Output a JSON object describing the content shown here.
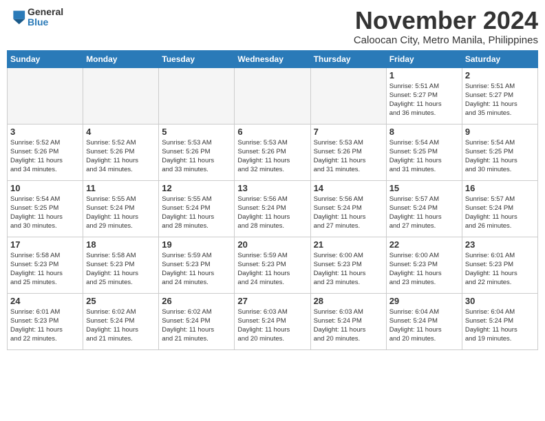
{
  "logo": {
    "general": "General",
    "blue": "Blue"
  },
  "title": "November 2024",
  "subtitle": "Caloocan City, Metro Manila, Philippines",
  "weekdays": [
    "Sunday",
    "Monday",
    "Tuesday",
    "Wednesday",
    "Thursday",
    "Friday",
    "Saturday"
  ],
  "weeks": [
    [
      {
        "day": "",
        "info": "",
        "empty": true
      },
      {
        "day": "",
        "info": "",
        "empty": true
      },
      {
        "day": "",
        "info": "",
        "empty": true
      },
      {
        "day": "",
        "info": "",
        "empty": true
      },
      {
        "day": "",
        "info": "",
        "empty": true
      },
      {
        "day": "1",
        "info": "Sunrise: 5:51 AM\nSunset: 5:27 PM\nDaylight: 11 hours\nand 36 minutes.",
        "empty": false
      },
      {
        "day": "2",
        "info": "Sunrise: 5:51 AM\nSunset: 5:27 PM\nDaylight: 11 hours\nand 35 minutes.",
        "empty": false
      }
    ],
    [
      {
        "day": "3",
        "info": "Sunrise: 5:52 AM\nSunset: 5:26 PM\nDaylight: 11 hours\nand 34 minutes.",
        "empty": false
      },
      {
        "day": "4",
        "info": "Sunrise: 5:52 AM\nSunset: 5:26 PM\nDaylight: 11 hours\nand 34 minutes.",
        "empty": false
      },
      {
        "day": "5",
        "info": "Sunrise: 5:53 AM\nSunset: 5:26 PM\nDaylight: 11 hours\nand 33 minutes.",
        "empty": false
      },
      {
        "day": "6",
        "info": "Sunrise: 5:53 AM\nSunset: 5:26 PM\nDaylight: 11 hours\nand 32 minutes.",
        "empty": false
      },
      {
        "day": "7",
        "info": "Sunrise: 5:53 AM\nSunset: 5:26 PM\nDaylight: 11 hours\nand 31 minutes.",
        "empty": false
      },
      {
        "day": "8",
        "info": "Sunrise: 5:54 AM\nSunset: 5:25 PM\nDaylight: 11 hours\nand 31 minutes.",
        "empty": false
      },
      {
        "day": "9",
        "info": "Sunrise: 5:54 AM\nSunset: 5:25 PM\nDaylight: 11 hours\nand 30 minutes.",
        "empty": false
      }
    ],
    [
      {
        "day": "10",
        "info": "Sunrise: 5:54 AM\nSunset: 5:25 PM\nDaylight: 11 hours\nand 30 minutes.",
        "empty": false
      },
      {
        "day": "11",
        "info": "Sunrise: 5:55 AM\nSunset: 5:24 PM\nDaylight: 11 hours\nand 29 minutes.",
        "empty": false
      },
      {
        "day": "12",
        "info": "Sunrise: 5:55 AM\nSunset: 5:24 PM\nDaylight: 11 hours\nand 28 minutes.",
        "empty": false
      },
      {
        "day": "13",
        "info": "Sunrise: 5:56 AM\nSunset: 5:24 PM\nDaylight: 11 hours\nand 28 minutes.",
        "empty": false
      },
      {
        "day": "14",
        "info": "Sunrise: 5:56 AM\nSunset: 5:24 PM\nDaylight: 11 hours\nand 27 minutes.",
        "empty": false
      },
      {
        "day": "15",
        "info": "Sunrise: 5:57 AM\nSunset: 5:24 PM\nDaylight: 11 hours\nand 27 minutes.",
        "empty": false
      },
      {
        "day": "16",
        "info": "Sunrise: 5:57 AM\nSunset: 5:24 PM\nDaylight: 11 hours\nand 26 minutes.",
        "empty": false
      }
    ],
    [
      {
        "day": "17",
        "info": "Sunrise: 5:58 AM\nSunset: 5:23 PM\nDaylight: 11 hours\nand 25 minutes.",
        "empty": false
      },
      {
        "day": "18",
        "info": "Sunrise: 5:58 AM\nSunset: 5:23 PM\nDaylight: 11 hours\nand 25 minutes.",
        "empty": false
      },
      {
        "day": "19",
        "info": "Sunrise: 5:59 AM\nSunset: 5:23 PM\nDaylight: 11 hours\nand 24 minutes.",
        "empty": false
      },
      {
        "day": "20",
        "info": "Sunrise: 5:59 AM\nSunset: 5:23 PM\nDaylight: 11 hours\nand 24 minutes.",
        "empty": false
      },
      {
        "day": "21",
        "info": "Sunrise: 6:00 AM\nSunset: 5:23 PM\nDaylight: 11 hours\nand 23 minutes.",
        "empty": false
      },
      {
        "day": "22",
        "info": "Sunrise: 6:00 AM\nSunset: 5:23 PM\nDaylight: 11 hours\nand 23 minutes.",
        "empty": false
      },
      {
        "day": "23",
        "info": "Sunrise: 6:01 AM\nSunset: 5:23 PM\nDaylight: 11 hours\nand 22 minutes.",
        "empty": false
      }
    ],
    [
      {
        "day": "24",
        "info": "Sunrise: 6:01 AM\nSunset: 5:23 PM\nDaylight: 11 hours\nand 22 minutes.",
        "empty": false
      },
      {
        "day": "25",
        "info": "Sunrise: 6:02 AM\nSunset: 5:24 PM\nDaylight: 11 hours\nand 21 minutes.",
        "empty": false
      },
      {
        "day": "26",
        "info": "Sunrise: 6:02 AM\nSunset: 5:24 PM\nDaylight: 11 hours\nand 21 minutes.",
        "empty": false
      },
      {
        "day": "27",
        "info": "Sunrise: 6:03 AM\nSunset: 5:24 PM\nDaylight: 11 hours\nand 20 minutes.",
        "empty": false
      },
      {
        "day": "28",
        "info": "Sunrise: 6:03 AM\nSunset: 5:24 PM\nDaylight: 11 hours\nand 20 minutes.",
        "empty": false
      },
      {
        "day": "29",
        "info": "Sunrise: 6:04 AM\nSunset: 5:24 PM\nDaylight: 11 hours\nand 20 minutes.",
        "empty": false
      },
      {
        "day": "30",
        "info": "Sunrise: 6:04 AM\nSunset: 5:24 PM\nDaylight: 11 hours\nand 19 minutes.",
        "empty": false
      }
    ]
  ]
}
